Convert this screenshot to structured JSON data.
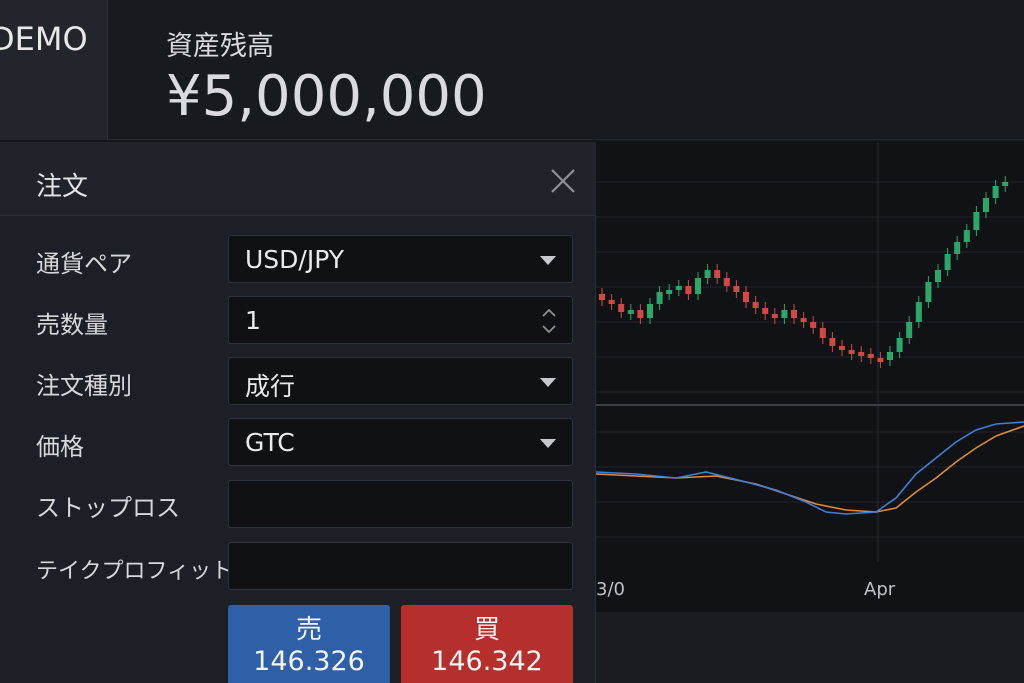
{
  "header": {
    "demo_label": "DEMO",
    "balance_label": "資産残高",
    "balance_value": "¥5,000,000"
  },
  "order_panel": {
    "title": "注文",
    "fields": {
      "currency_pair": {
        "label": "通貨ペア",
        "value": "USD/JPY"
      },
      "quantity": {
        "label": "売数量",
        "value": "1"
      },
      "order_type": {
        "label": "注文種別",
        "value": "成行"
      },
      "price": {
        "label": "価格",
        "value": "GTC"
      },
      "stop_loss": {
        "label": "ストップロス",
        "value": ""
      },
      "take_profit": {
        "label": "テイクプロフィット",
        "value": ""
      }
    },
    "sell": {
      "label": "売",
      "price": "146.326"
    },
    "buy": {
      "label": "買",
      "price": "146.342"
    }
  },
  "chart": {
    "x_tick_left": "3/0",
    "x_tick_right": "Apr",
    "colors": {
      "up": "#2ea66a",
      "down": "#d04a45",
      "line_fast": "#3f7fd8",
      "line_slow": "#e08a35"
    }
  }
}
